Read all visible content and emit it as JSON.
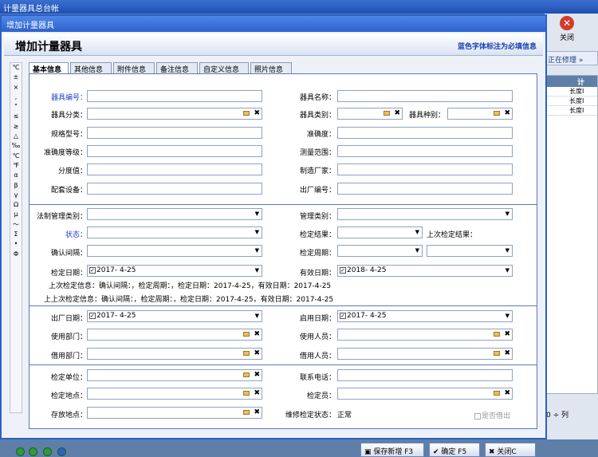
{
  "app": {
    "title": "计量器具总台帐",
    "close_label": "关闭",
    "fixing_label": "正在修理",
    "grid_header": "计",
    "grid_rows": [
      "长度I",
      "长度I",
      "长度I"
    ],
    "rows_label": "列",
    "rows_value": "0"
  },
  "dialog": {
    "title": "增加计量器具",
    "header": "增加计量器具",
    "note": "蓝色字体标注为必填信息"
  },
  "symbols": [
    "℃",
    "±",
    "×",
    ",",
    "\"",
    "≤",
    "≥",
    "△",
    "‰",
    "℃",
    "℉",
    "α",
    "β",
    "γ",
    "Ω",
    "μ",
    "～",
    "Σ",
    "•",
    "Φ"
  ],
  "tabs": [
    "基本信息",
    "其他信息",
    "附件信息",
    "备注信息",
    "自定义信息",
    "照片信息"
  ],
  "labels": {
    "code": "器具编号：",
    "name": "器具名称：",
    "class": "器具分类：",
    "type": "器具类别：",
    "kind": "器具种别：",
    "model": "规格型号：",
    "accuracy": "准确度：",
    "acc_grade": "准确度等级：",
    "range": "测量范围：",
    "division": "分度值：",
    "maker": "制造厂家：",
    "equip": "配套设备：",
    "serial": "出厂编号：",
    "legal": "法制管理类别：",
    "mgmt": "管理类别：",
    "status": "状态：",
    "result": "检定结果：",
    "last_result": "上次检定结果：",
    "interval": "确认间隔：",
    "period": "检定周期：",
    "check_date": "检定日期：",
    "valid_date": "有效日期：",
    "ship_date": "出厂日期：",
    "start_date": "启用日期：",
    "dept": "使用部门：",
    "user": "使用人员：",
    "borrow_dept": "借用部门：",
    "borrow_user": "借用人员：",
    "unit": "检定单位：",
    "phone": "联系电话：",
    "place": "检定地点：",
    "inspector": "检定员：",
    "storage": "存放地点：",
    "repair": "维修检定状态：",
    "repair_val": "正常",
    "lend": "是否借出"
  },
  "values": {
    "check_date": "2017- 4-25",
    "valid_date": "2018- 4-25",
    "ship_date": "2017- 4-25",
    "start_date": "2017- 4-25"
  },
  "info": {
    "last": "上次检定信息：确认间隔：，检定周期：，检定日期：2017-4-25，有效日期：2017-4-25",
    "last2": "上上次检定信息：确认间隔：，检定周期：，检定日期：2017-4-25，有效日期：2017-4-25"
  },
  "buttons": {
    "save_new": "保存新增 F3",
    "ok": "确定 F5",
    "close": "关闭C"
  }
}
